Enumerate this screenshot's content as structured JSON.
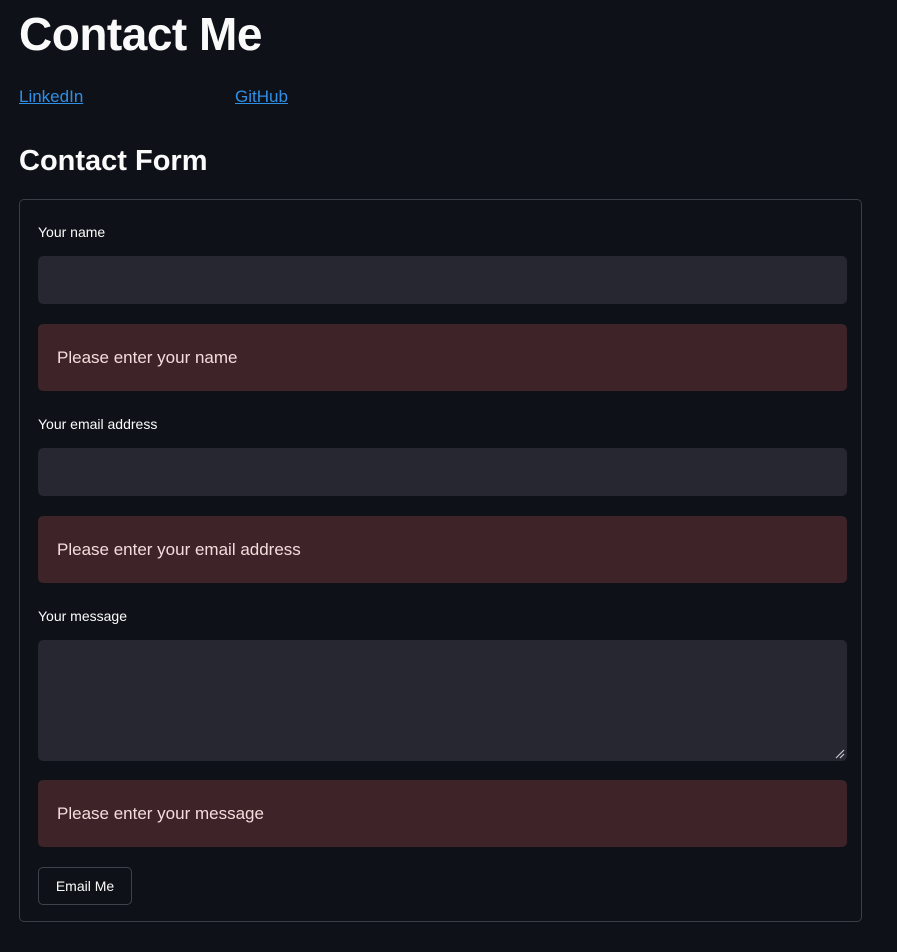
{
  "page": {
    "title": "Contact Me",
    "links": {
      "linkedin": "LinkedIn",
      "github": "GitHub"
    },
    "link_color": "#2f8fe6"
  },
  "form": {
    "title": "Contact Form",
    "name_field": {
      "label": "Your name",
      "value": "",
      "error": "Please enter your name"
    },
    "email_field": {
      "label": "Your email address",
      "value": "",
      "error": "Please enter your email address"
    },
    "message_field": {
      "label": "Your message",
      "value": "",
      "error": "Please enter your message"
    },
    "submit_label": "Email Me"
  },
  "colors": {
    "background": "#0e1117",
    "input_background": "#262730",
    "error_background": "#3e2428",
    "error_text": "#f3dcdc"
  }
}
